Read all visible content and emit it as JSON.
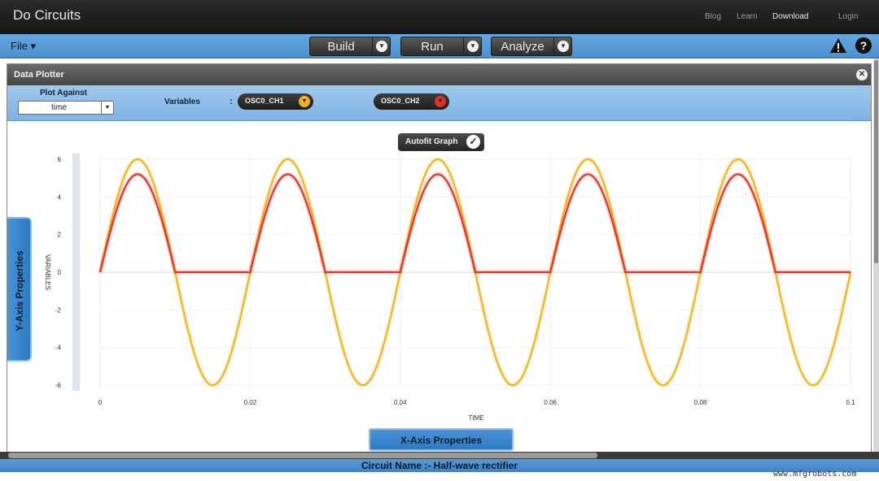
{
  "app": {
    "title": "Do Circuits"
  },
  "top_nav": {
    "blog": "Blog",
    "learn": "Learn",
    "download": "Download",
    "login": "Login"
  },
  "toolbar": {
    "file_menu": "File ▾",
    "build_label": "Build",
    "run_label": "Run",
    "analyze_label": "Analyze"
  },
  "panel": {
    "title": "Data Plotter",
    "plot_against_label": "Plot Against",
    "plot_against_value": "time",
    "variables_label": "Variables",
    "colon": ":",
    "variables": [
      {
        "label": "OSC0_CH1",
        "color": "#f2b21a"
      },
      {
        "label": "OSC0_CH2",
        "color": "#e0302a"
      }
    ],
    "autofit_label": "Autofit Graph",
    "yaxis_properties_label": "Y-Axis Properties",
    "xaxis_properties_label": "X-Axis Properties"
  },
  "status": {
    "circuit_name": "Circuit Name :- Half-wave rectifier"
  },
  "watermark": "www.mfgrobots.com",
  "icons": {
    "file_dropdown": "chevron-down-icon",
    "warning": "warning-icon",
    "help": "help-icon",
    "close": "close-icon",
    "autofit": "check-icon"
  },
  "chart_data": {
    "type": "line",
    "xlabel": "TIME",
    "ylabel": "VARIABLES",
    "xlim": [
      0,
      0.1
    ],
    "ylim": [
      -6.3,
      6.3
    ],
    "x_ticks": [
      "0",
      "0.02",
      "0.04",
      "0.06",
      "0.08",
      "0.1"
    ],
    "y_ticks": [
      "6",
      "4",
      "2",
      "0",
      "-2",
      "-4",
      "-6"
    ],
    "grid": true,
    "legend": "none",
    "series": [
      {
        "name": "OSC0_CH1",
        "color": "#f2b21a",
        "kind": "sine",
        "amplitude": 6,
        "frequency_hz": 50
      },
      {
        "name": "OSC0_CH2",
        "color": "#e0302a",
        "kind": "half-wave",
        "amplitude": 5.2,
        "frequency_hz": 50
      }
    ]
  }
}
